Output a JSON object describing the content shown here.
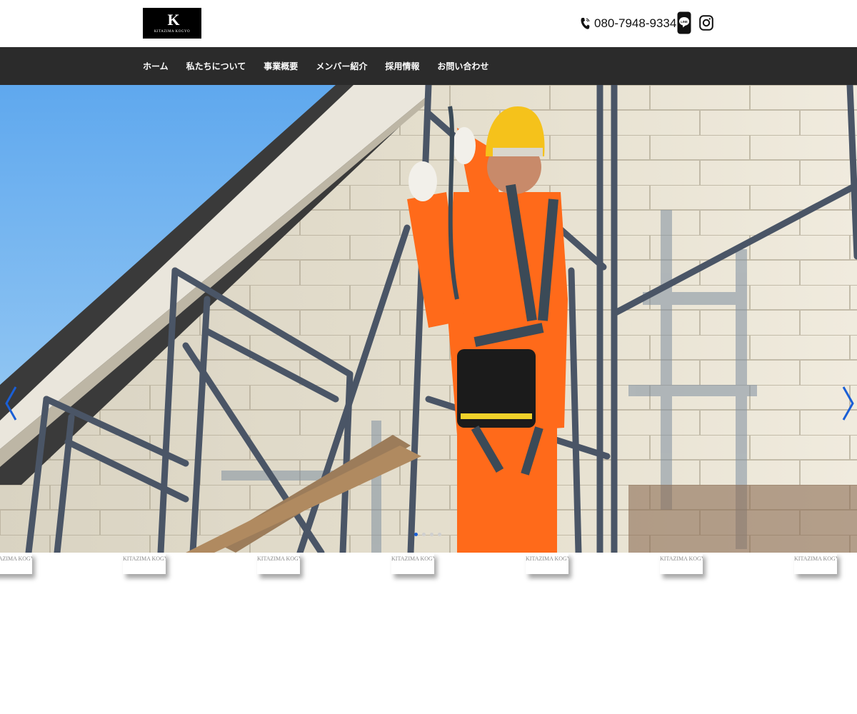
{
  "header": {
    "logo": {
      "mark": "K",
      "text": "KITAZIMA KOGYO"
    },
    "phone": "080-7948-9334",
    "social": {
      "line_label": "LINE",
      "instagram_icon": "instagram-icon"
    }
  },
  "nav": {
    "items": [
      {
        "label": "ホーム"
      },
      {
        "label": "私たちについて"
      },
      {
        "label": "事業概要"
      },
      {
        "label": "メンバー紹介"
      },
      {
        "label": "採用情報"
      },
      {
        "label": "お問い合わせ"
      }
    ]
  },
  "hero": {
    "image": "construction-worker-on-scaffolding",
    "slides": 4,
    "active_slide": 1,
    "arrow_color": "#1a5fd6"
  },
  "watermarks": {
    "text": "KITAZIMA KOGYO"
  },
  "colors": {
    "nav_bg": "#2b2b2b",
    "accent": "#1a5fd6",
    "worker_suit": "#ff6a1a",
    "helmet": "#f5c21b"
  }
}
